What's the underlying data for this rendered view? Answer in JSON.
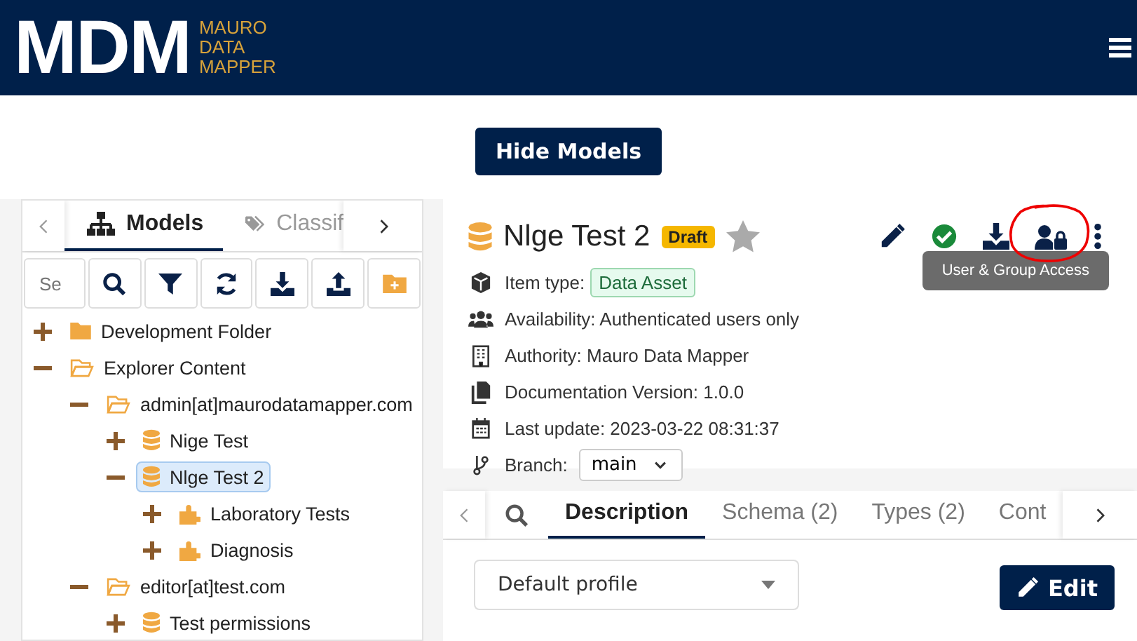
{
  "header": {
    "logo": "MDM",
    "logo_sub": [
      "MAURO",
      "DATA",
      "MAPPER"
    ]
  },
  "hide_button": "Hide Models",
  "left_tabs": [
    {
      "label": "Models",
      "kind": "models",
      "selected": true
    },
    {
      "label": "Classif",
      "kind": "classifiers",
      "selected": false
    }
  ],
  "tree_search": {
    "placeholder": "Se"
  },
  "tree": [
    {
      "label": "Development Folder",
      "kind": "folder",
      "expanded": false,
      "selected": false
    },
    {
      "label": "Explorer Content",
      "kind": "folder",
      "expanded": true,
      "selected": false,
      "children": [
        {
          "label": "admin[at]maurodatamapper.com",
          "kind": "folder",
          "expanded": true,
          "selected": false,
          "children": [
            {
              "label": "Nige Test",
              "kind": "model",
              "expanded": false,
              "selected": false
            },
            {
              "label": "Nlge Test 2",
              "kind": "model",
              "expanded": true,
              "selected": true,
              "children": [
                {
                  "label": "Laboratory Tests",
                  "kind": "class",
                  "expanded": false,
                  "selected": false
                },
                {
                  "label": "Diagnosis",
                  "kind": "class",
                  "expanded": false,
                  "selected": false
                }
              ]
            }
          ]
        },
        {
          "label": "editor[at]test.com",
          "kind": "folder",
          "expanded": true,
          "selected": false,
          "children": [
            {
              "label": "Test permissions",
              "kind": "model",
              "expanded": false,
              "selected": false
            }
          ]
        }
      ]
    }
  ],
  "detail": {
    "title": "Nlge Test 2",
    "badge": "Draft",
    "favourite": false,
    "actions": [
      {
        "kind": "edit",
        "circled": false
      },
      {
        "kind": "finalise",
        "circled": false
      },
      {
        "kind": "download",
        "circled": false
      },
      {
        "kind": "access",
        "circled": true
      },
      {
        "kind": "more",
        "circled": false
      }
    ],
    "tooltip": "User & Group Access",
    "fields": [
      {
        "kind": "type",
        "label": "Item type:",
        "value": "Data Asset"
      },
      {
        "kind": "availability",
        "label": "Availability: Authenticated users only"
      },
      {
        "kind": "authority",
        "label": "Authority: Mauro Data Mapper"
      },
      {
        "kind": "docs",
        "label": "Documentation Version: 1.0.0"
      },
      {
        "kind": "date",
        "label": "Last update: 2023-03-22 08:31:37"
      },
      {
        "kind": "branch",
        "label": "Branch:",
        "value": "main"
      }
    ]
  },
  "content_tabs": [
    {
      "label": "Description",
      "selected": true
    },
    {
      "label": "Schema (2)",
      "selected": false
    },
    {
      "label": "Types (2)",
      "selected": false
    },
    {
      "label": "Cont",
      "selected": false
    }
  ],
  "profile_select": "Default profile",
  "edit_button": "Edit"
}
